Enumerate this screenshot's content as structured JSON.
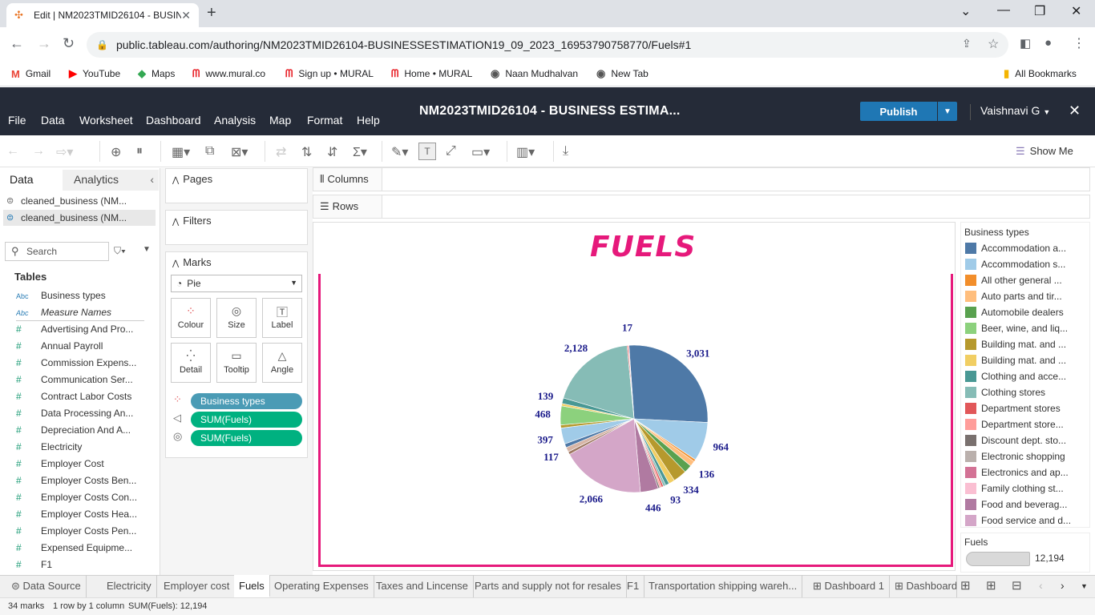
{
  "browser": {
    "tab_title": "Edit | NM2023TMID26104 - BUSINES",
    "url": "public.tableau.com/authoring/NM2023TMID26104-BUSINESSESTIMATION19_09_2023_16953790758770/Fuels#1",
    "bookmarks": [
      "Gmail",
      "YouTube",
      "Maps",
      "www.mural.co",
      "Sign up • MURAL",
      "Home • MURAL",
      "Naan Mudhalvan",
      "New Tab"
    ],
    "all_bookmarks": "All Bookmarks"
  },
  "app": {
    "menu": [
      "File",
      "Data",
      "Worksheet",
      "Dashboard",
      "Analysis",
      "Map",
      "Format",
      "Help"
    ],
    "workbook_title": "NM2023TMID26104 - BUSINESS ESTIMA...",
    "publish_label": "Publish",
    "user": "Vaishnavi G",
    "show_me": "Show Me"
  },
  "data_pane": {
    "tab_data": "Data",
    "tab_analytics": "Analytics",
    "sources": [
      "cleaned_business (NM...",
      "cleaned_business (NM..."
    ],
    "search_placeholder": "Search",
    "tables_label": "Tables",
    "fields": [
      {
        "type": "Abc",
        "name": "Business types"
      },
      {
        "type": "Abc",
        "name": "Measure Names"
      },
      {
        "type": "#",
        "name": "Advertising And Pro..."
      },
      {
        "type": "#",
        "name": "Annual Payroll"
      },
      {
        "type": "#",
        "name": "Commission Expens..."
      },
      {
        "type": "#",
        "name": "Communication Ser..."
      },
      {
        "type": "#",
        "name": "Contract Labor Costs"
      },
      {
        "type": "#",
        "name": "Data Processing An..."
      },
      {
        "type": "#",
        "name": "Depreciation And A..."
      },
      {
        "type": "#",
        "name": "Electricity"
      },
      {
        "type": "#",
        "name": "Employer Cost"
      },
      {
        "type": "#",
        "name": "Employer Costs Ben..."
      },
      {
        "type": "#",
        "name": "Employer Costs Con..."
      },
      {
        "type": "#",
        "name": "Employer Costs Hea..."
      },
      {
        "type": "#",
        "name": "Employer Costs Pen..."
      },
      {
        "type": "#",
        "name": "Expensed Equipme..."
      },
      {
        "type": "#",
        "name": "F1"
      }
    ]
  },
  "shelves": {
    "pages": "Pages",
    "filters": "Filters",
    "marks": "Marks",
    "mark_type": "Pie",
    "mark_buttons": [
      "Colour",
      "Size",
      "Label",
      "Detail",
      "Tooltip",
      "Angle"
    ],
    "pills": [
      {
        "label": "Business types",
        "color": "#4a9bb5"
      },
      {
        "label": "SUM(Fuels)",
        "color": "#00b180"
      },
      {
        "label": "SUM(Fuels)",
        "color": "#00b180"
      }
    ],
    "columns": "Columns",
    "rows": "Rows"
  },
  "viz": {
    "title": "FUELS",
    "title_color": "#e6197b"
  },
  "chart_data": {
    "type": "pie",
    "title": "FUELS",
    "total": 12194,
    "slices": [
      {
        "label": "3,031",
        "value": 3031,
        "color": "#4e79a7"
      },
      {
        "label": "964",
        "value": 964,
        "color": "#a0cbe8"
      },
      {
        "label": "",
        "value": 55,
        "color": "#f28e2b"
      },
      {
        "label": "136",
        "value": 136,
        "color": "#ffbe7d"
      },
      {
        "label": "",
        "value": 200,
        "color": "#59a14f"
      },
      {
        "label": "334",
        "value": 334,
        "color": "#b6992d"
      },
      {
        "label": "",
        "value": 150,
        "color": "#f1ce63"
      },
      {
        "label": "93",
        "value": 93,
        "color": "#499894"
      },
      {
        "label": "",
        "value": 60,
        "color": "#86bcb6"
      },
      {
        "label": "",
        "value": 50,
        "color": "#e15759"
      },
      {
        "label": "",
        "value": 45,
        "color": "#ff9d9a"
      },
      {
        "label": "",
        "value": 40,
        "color": "#79706e"
      },
      {
        "label": "446",
        "value": 446,
        "color": "#b07aa1"
      },
      {
        "label": "2,066",
        "value": 2066,
        "color": "#d4a6c8"
      },
      {
        "label": "",
        "value": 70,
        "color": "#9d7660"
      },
      {
        "label": "117",
        "value": 117,
        "color": "#d7b5a6"
      },
      {
        "label": "",
        "value": 95,
        "color": "#4e79a7"
      },
      {
        "label": "397",
        "value": 397,
        "color": "#a0cbe8"
      },
      {
        "label": "",
        "value": 75,
        "color": "#b6992d"
      },
      {
        "label": "468",
        "value": 468,
        "color": "#8cd17d"
      },
      {
        "label": "",
        "value": 60,
        "color": "#f1ce63"
      },
      {
        "label": "139",
        "value": 139,
        "color": "#499894"
      },
      {
        "label": "2,128",
        "value": 2128,
        "color": "#86bcb6"
      },
      {
        "label": "",
        "value": 30,
        "color": "#e15759"
      },
      {
        "label": "17",
        "value": 17,
        "color": "#ff9d9a"
      }
    ]
  },
  "legend": {
    "title": "Business types",
    "items": [
      {
        "name": "Accommodation a...",
        "color": "#4e79a7"
      },
      {
        "name": "Accommodation s...",
        "color": "#a0cbe8"
      },
      {
        "name": "All other general ...",
        "color": "#f28e2b"
      },
      {
        "name": "Auto parts and tir...",
        "color": "#ffbe7d"
      },
      {
        "name": "Automobile dealers",
        "color": "#59a14f"
      },
      {
        "name": "Beer, wine, and liq...",
        "color": "#8cd17d"
      },
      {
        "name": "Building mat. and ...",
        "color": "#b6992d"
      },
      {
        "name": "Building mat. and ...",
        "color": "#f1ce63"
      },
      {
        "name": "Clothing and acce...",
        "color": "#499894"
      },
      {
        "name": "Clothing stores",
        "color": "#86bcb6"
      },
      {
        "name": "Department stores",
        "color": "#e15759"
      },
      {
        "name": "Department store...",
        "color": "#ff9d9a"
      },
      {
        "name": "Discount dept. sto...",
        "color": "#79706e"
      },
      {
        "name": "Electronic shopping",
        "color": "#bab0ac"
      },
      {
        "name": "Electronics and ap...",
        "color": "#d37295"
      },
      {
        "name": "Family clothing st...",
        "color": "#fabfd2"
      },
      {
        "name": "Food and beverag...",
        "color": "#b07aa1"
      },
      {
        "name": "Food service and d...",
        "color": "#d4a6c8"
      }
    ],
    "size_title": "Fuels",
    "size_value": "12,194"
  },
  "sheet_tabs": [
    "Data Source",
    "Electricity",
    "Employer cost",
    "Fuels",
    "Operating Expenses",
    "Taxes and Lincense",
    "Parts and supply not for resales",
    "F1",
    "Transportation shipping wareh...",
    "Dashboard 1",
    "Dashboard"
  ],
  "active_tab": "Fuels",
  "status": {
    "marks": "34 marks",
    "dims": "1 row by 1 column",
    "sum": "SUM(Fuels): 12,194"
  }
}
